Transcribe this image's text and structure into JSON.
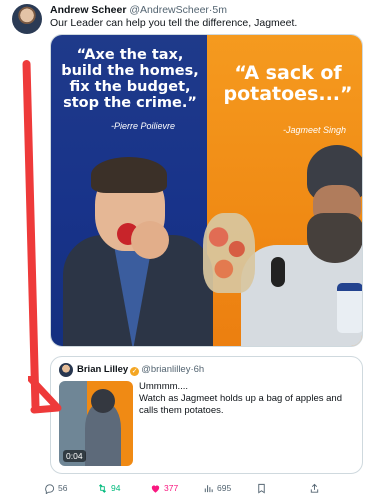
{
  "post": {
    "author_name": "Andrew Scheer",
    "author_handle": "@AndrewScheer",
    "separator": "·",
    "time": "5m",
    "text": "Our Leader can help you tell the difference, Jagmeet."
  },
  "media": {
    "left_quote": [
      "“Axe the tax,",
      "build the homes,",
      "fix the budget,",
      "stop the crime.”"
    ],
    "left_attribution": "-Pierre Poilievre",
    "right_quote": [
      "“A sack of",
      "potatoes...”"
    ],
    "right_attribution": "-Jagmeet Singh",
    "left_color": "#1f3a8a",
    "right_color": "#f08a14"
  },
  "quoted": {
    "author_name": "Brian Lilley",
    "author_handle": "@brianlilley",
    "separator": "·",
    "time": "6h",
    "lines": [
      "Ummmm....",
      "Watch as Jagmeet holds up a bag of apples and calls them potatoes."
    ],
    "video_duration": "0:04"
  },
  "actions": {
    "replies": "56",
    "retweets": "94",
    "likes": "377",
    "views": "695"
  },
  "colors": {
    "arrow": "#ee3a3a",
    "retweet": "#00ba7c",
    "like": "#f91880"
  }
}
